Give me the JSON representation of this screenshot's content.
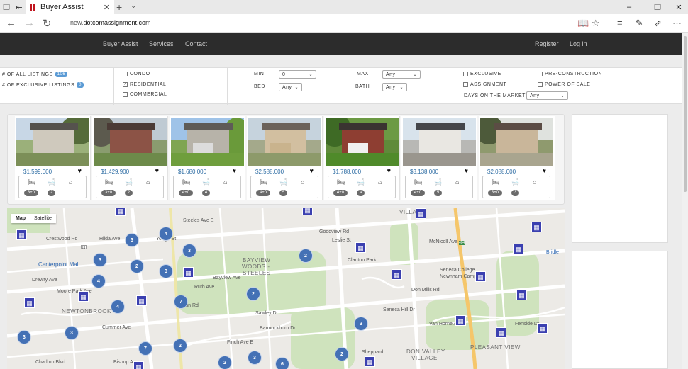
{
  "browser": {
    "tab_title": "Buyer Assist",
    "url_prefix": "new.",
    "url_host": "dotcomassignment.com"
  },
  "nav": {
    "items": [
      "Buyer Assist",
      "Services",
      "Contact"
    ],
    "register": "Register",
    "login": "Log in"
  },
  "filters": {
    "all_listings_label": "# OF ALL LISTINGS",
    "all_listings_count": "106",
    "exclusive_listings_label": "# OF EXCLUSIVE LISTINGS",
    "exclusive_listings_count": "0",
    "types": [
      {
        "label": "CONDO",
        "checked": false
      },
      {
        "label": "RESIDENTIAL",
        "checked": true
      },
      {
        "label": "COMMERCIAL",
        "checked": false
      }
    ],
    "min_label": "MIN",
    "min_value": "0",
    "bed_label": "BED",
    "bed_value": "Any",
    "max_label": "MAX",
    "max_value": "Any",
    "bath_label": "BATH",
    "bath_value": "Any",
    "options": [
      {
        "label": "EXCLUSIVE",
        "checked": false
      },
      {
        "label": "ASSIGNMENT",
        "checked": false
      },
      {
        "label": "PRE-CONSTRUCTION",
        "checked": false
      },
      {
        "label": "POWER OF SALE",
        "checked": false
      }
    ],
    "days_label": "DAYS ON THE MARKET",
    "days_value": "Any"
  },
  "listings": [
    {
      "price": "$1,599,000",
      "beds": "3+0",
      "baths": "2"
    },
    {
      "price": "$1,429,900",
      "beds": "3+0",
      "baths": "2"
    },
    {
      "price": "$1,680,000",
      "beds": "4+0",
      "baths": "4"
    },
    {
      "price": "$2,588,000",
      "beds": "4+0",
      "baths": "5"
    },
    {
      "price": "$1,788,000",
      "beds": "4+0",
      "baths": "4"
    },
    {
      "price": "$3,138,000",
      "beds": "4+0",
      "baths": "5"
    },
    {
      "price": "$2,088,000",
      "beds": "3+0",
      "baths": "3"
    }
  ],
  "map": {
    "type_map": "Map",
    "type_satellite": "Satellite",
    "labels": {
      "centerpoint": "Centerpoint Mall",
      "newtonbrook": "NEWTONBROOK",
      "bayview1": "BAYVIEW",
      "bayview2": "WOODS -",
      "bayview3": "STEELES",
      "seneca1": "Seneca College",
      "seneca2": "Newnham Campus",
      "don_valley1": "DON VALLEY",
      "don_valley2": "VILLAGE",
      "pleasant_view": "PLEASANT VIEW",
      "villa": "VILLA",
      "bridle": "Bridle",
      "steeles_ave_e": "Steeles Ave E",
      "finch_ave_e": "Finch Ave E",
      "cummer_ave": "Cummer Ave",
      "drewry_ave": "Drewry Ave",
      "yonge_st": "Yonge St",
      "bayview_ave": "Bayview Ave",
      "leslie_st": "Leslie St",
      "don_mills_rd": "Don Mills Rd",
      "mcnicoll_ave": "McNicoll Ave",
      "van_horne_ave": "Van Horne Ave",
      "sheppard": "Sheppard",
      "ruth_ave": "Ruth Ave",
      "hilda_ave": "Hilda Ave",
      "moore_park": "Moore Park Ave",
      "bishop_ave": "Bishop Ave",
      "charlton_blvd": "Charlton Blvd",
      "crestwood_rd": "Crestwood Rd",
      "goodview_rd": "Goodview Rd",
      "seneca_hill": "Seneca Hill Dr",
      "fenside_dr": "Fenside Dr",
      "clanton_park": "Clanton Park",
      "sawley_dr": "Sawley Dr",
      "bannockburn": "Bannockburn Dr",
      "marlin_rd": "Marlin Rd",
      "route_11": "11",
      "route_404": "404"
    },
    "clusters": [
      "4",
      "3",
      "3",
      "3",
      "2",
      "2",
      "4",
      "3",
      "2",
      "4",
      "7",
      "3",
      "3",
      "3",
      "7",
      "2",
      "2",
      "3",
      "2",
      "6",
      "2",
      "2",
      "2"
    ]
  }
}
